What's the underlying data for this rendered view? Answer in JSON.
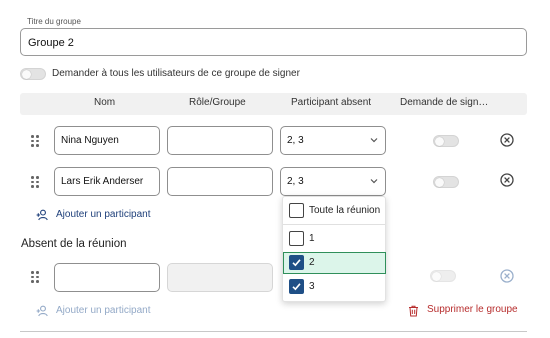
{
  "group_name": {
    "legend": "Titre du groupe",
    "value": "Groupe 2"
  },
  "ask_all_signers": {
    "label": "Demander à tous les utilisateurs de ce groupe de signer",
    "enabled": false
  },
  "table": {
    "headers": [
      "Nom",
      "Rôle/Groupe",
      "Participant absent",
      "Demande de sign…"
    ]
  },
  "participants": [
    {
      "name": "Nina Nguyen",
      "role": "",
      "absent_selection": "2, 3",
      "sign_request": false
    },
    {
      "name": "Lars Erik Anderser",
      "role": "",
      "absent_selection": "2, 3",
      "sign_request": false
    }
  ],
  "add_participant_label": "Ajouter un participant",
  "absent_section": {
    "heading": "Absent de la réunion",
    "row": {
      "name": "",
      "role": "",
      "sign_request": false
    },
    "add_participant_label": "Ajouter un participant"
  },
  "absent_dropdown": {
    "all_option": {
      "label": "Toute la réunion",
      "checked": false
    },
    "options": [
      {
        "label": "1",
        "checked": false
      },
      {
        "label": "2",
        "checked": true
      },
      {
        "label": "3",
        "checked": true
      }
    ]
  },
  "delete_group_label": "Supprimer le groupe",
  "colors": {
    "accent": "#1f4f86",
    "danger": "#b72d2d",
    "highlight": "#dcf5ea",
    "highlight_border": "#2f8f5a"
  },
  "icons": [
    "drag-handle-icon",
    "chevron-down-icon",
    "close-circle-icon",
    "add-person-icon",
    "trash-icon",
    "checkmark-icon"
  ]
}
